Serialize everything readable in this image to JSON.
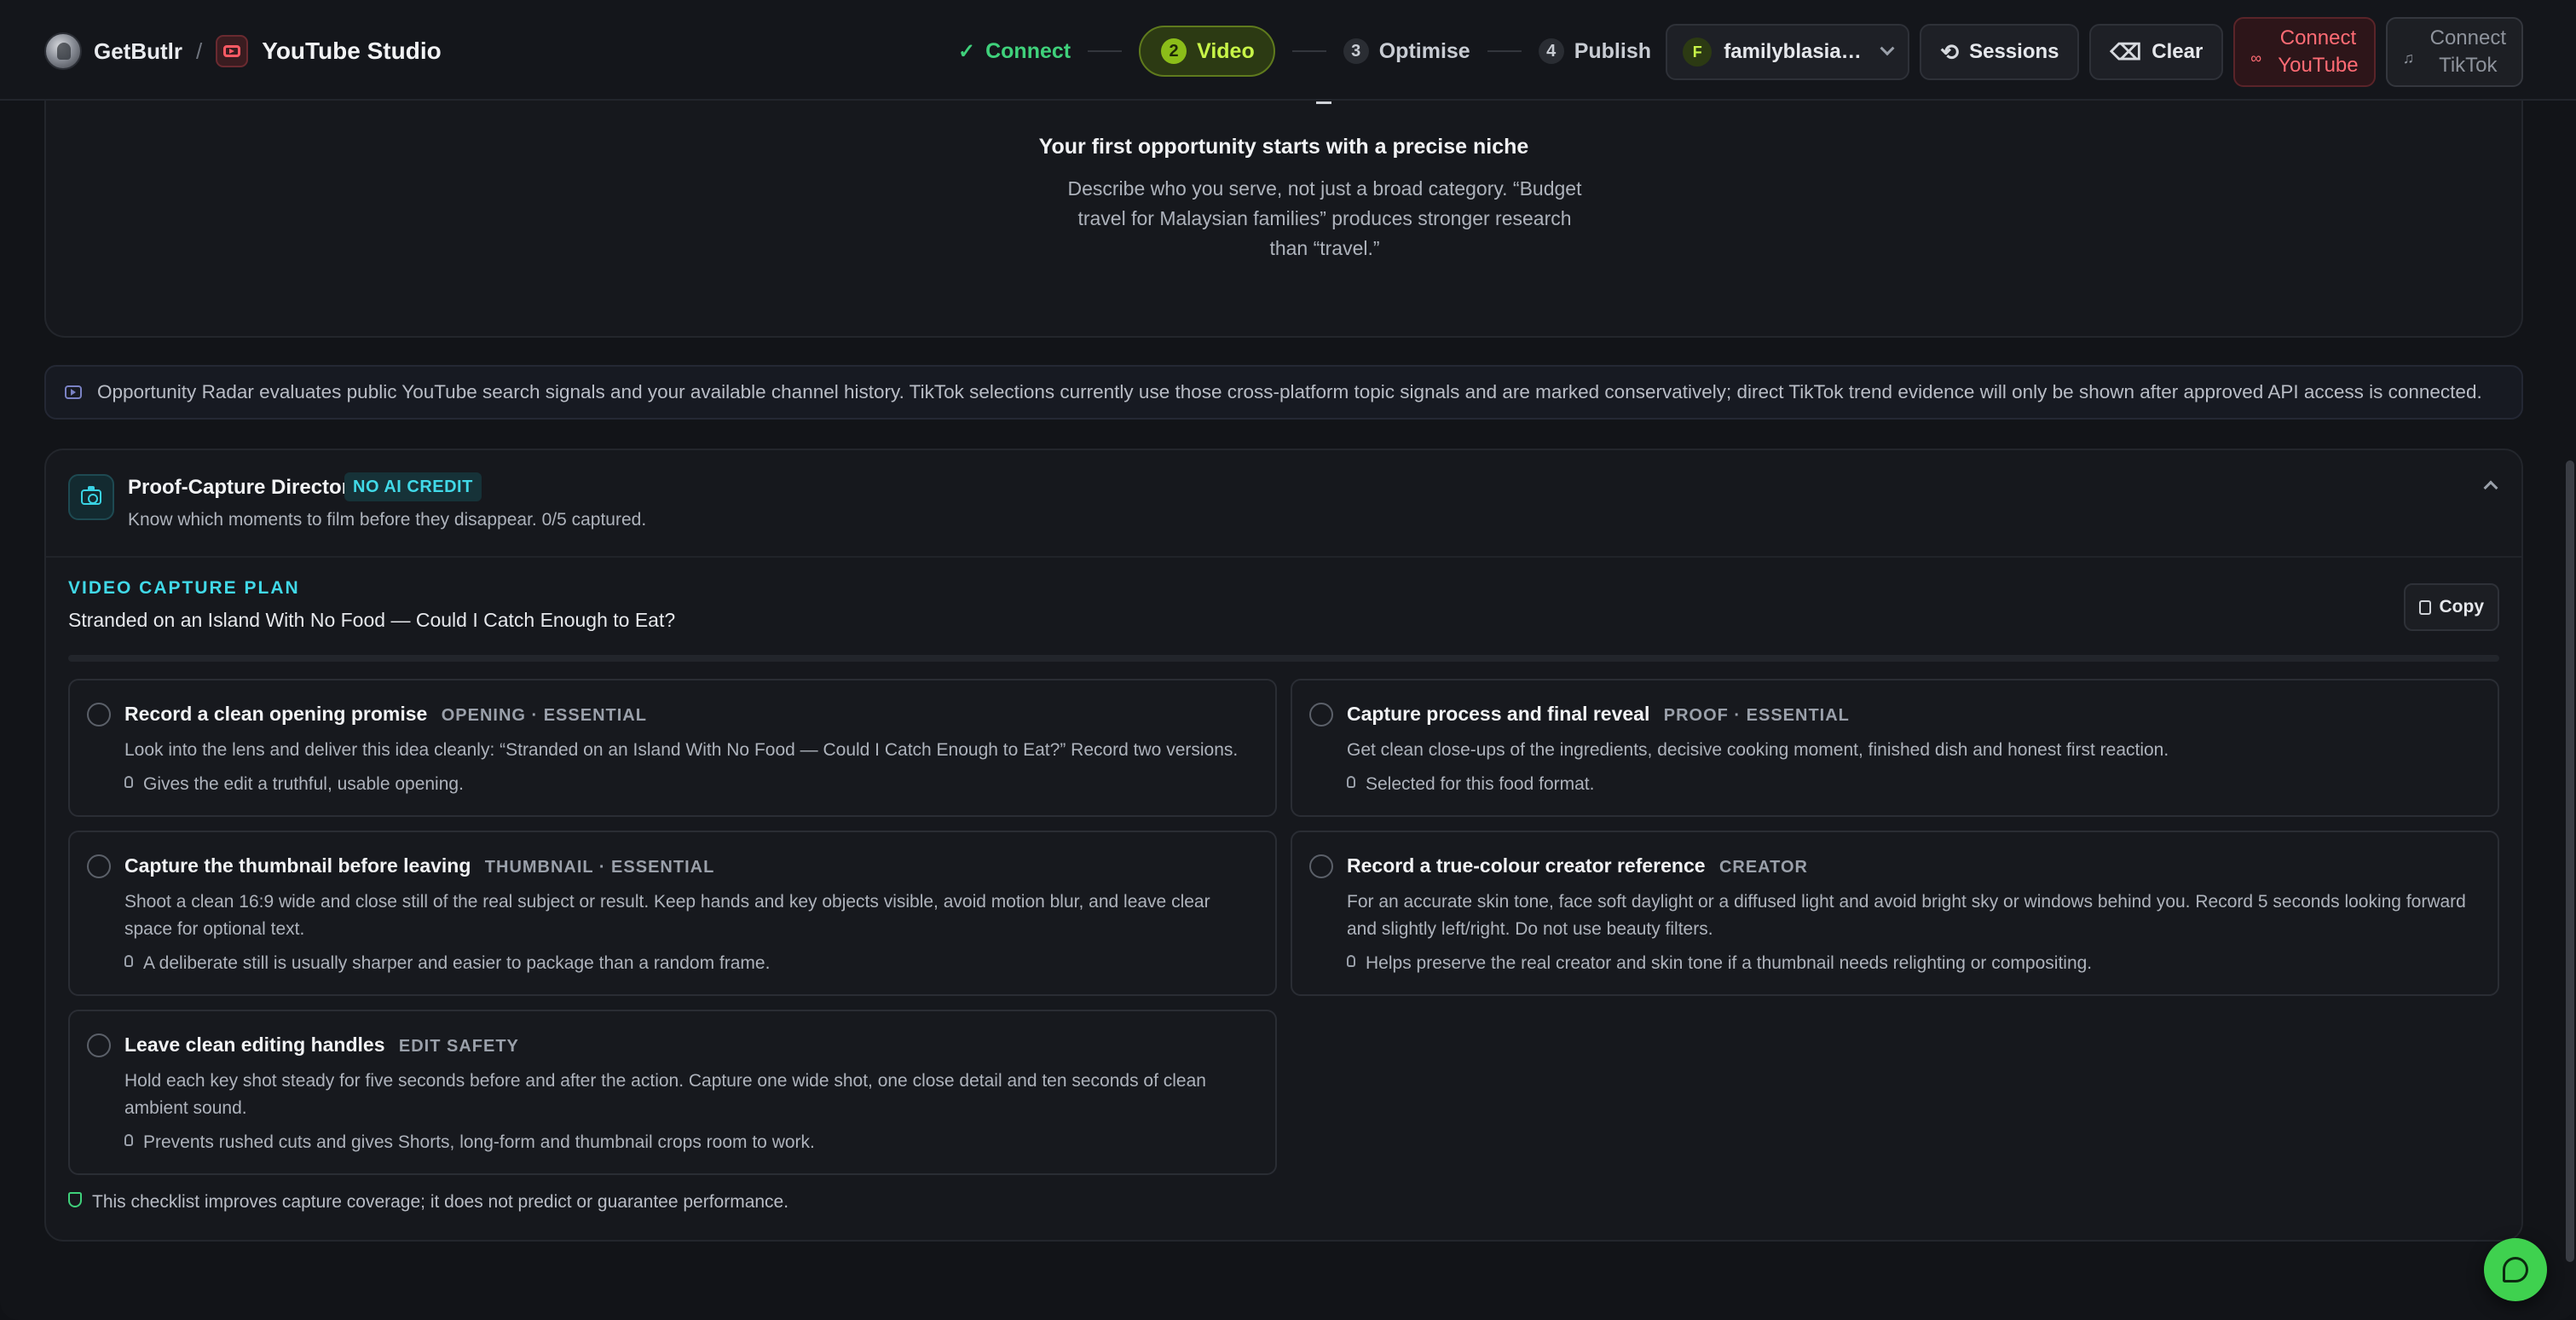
{
  "header": {
    "brand": "GetButlr",
    "separator": "/",
    "studio": "YouTube Studio",
    "steps": [
      {
        "num": "",
        "label": "Connect",
        "state": "done"
      },
      {
        "num": "2",
        "label": "Video",
        "state": "active"
      },
      {
        "num": "3",
        "label": "Optimise",
        "state": "pending"
      },
      {
        "num": "4",
        "label": "Publish",
        "state": "pending"
      }
    ],
    "account_initial": "F",
    "account_name": "familyblasian...",
    "sessions_label": "Sessions",
    "clear_label": "Clear",
    "connect_youtube_label": "Connect YouTube",
    "connect_youtube_line1": "Connect",
    "connect_youtube_line2": "YouTube",
    "connect_tiktok_line1": "Connect",
    "connect_tiktok_line2": "TikTok"
  },
  "niche": {
    "title": "Your first opportunity starts with a precise niche",
    "description": "Describe who you serve, not just a broad category. “Budget travel for Malaysian families” produces stronger research than “travel.”"
  },
  "radar": {
    "text": "Opportunity Radar evaluates public YouTube search signals and your available channel history. TikTok selections currently use those cross-platform topic signals and are marked conservatively; direct TikTok trend evidence will only be shown after approved API access is connected."
  },
  "director": {
    "title": "Proof-Capture Director",
    "badge": "NO AI CREDIT",
    "subtitle": "Know which moments to film before they disappear. 0/5 captured.",
    "captured": 0,
    "total": 5,
    "plan_kicker": "VIDEO CAPTURE PLAN",
    "plan_title": "Stranded on an Island With No Food — Could I Catch Enough to Eat?",
    "copy_label": "Copy",
    "items": [
      {
        "title": "Record a clean opening promise",
        "tag": "OPENING · ESSENTIAL",
        "description": "Look into the lens and deliver this idea cleanly: “Stranded on an Island With No Food — Could I Catch Enough to Eat?” Record two versions.",
        "why": "Gives the edit a truthful, usable opening.",
        "checked": false
      },
      {
        "title": "Capture process and final reveal",
        "tag": "PROOF · ESSENTIAL",
        "description": "Get clean close-ups of the ingredients, decisive cooking moment, finished dish and honest first reaction.",
        "why": "Selected for this food format.",
        "checked": false
      },
      {
        "title": "Capture the thumbnail before leaving",
        "tag": "THUMBNAIL · ESSENTIAL",
        "description": "Shoot a clean 16:9 wide and close still of the real subject or result. Keep hands and key objects visible, avoid motion blur, and leave clear space for optional text.",
        "why": "A deliberate still is usually sharper and easier to package than a random frame.",
        "checked": false
      },
      {
        "title": "Record a true-colour creator reference",
        "tag": "CREATOR",
        "description": "For an accurate skin tone, face soft daylight or a diffused light and avoid bright sky or windows behind you. Record 5 seconds looking forward and slightly left/right. Do not use beauty filters.",
        "why": "Helps preserve the real creator and skin tone if a thumbnail needs relighting or compositing.",
        "checked": false
      },
      {
        "title": "Leave clean editing handles",
        "tag": "EDIT SAFETY",
        "description": "Hold each key shot steady for five seconds before and after the action. Capture one wide shot, one close detail and ten seconds of clean ambient sound.",
        "why": "Prevents rushed cuts and gives Shorts, long-form and thumbnail crops room to work.",
        "checked": false
      }
    ],
    "footnote": "This checklist improves capture coverage; it does not predict or guarantee performance."
  },
  "colors": {
    "accent_cyan": "#41d9e8",
    "accent_lime": "#c8f548",
    "success_green": "#3fd17b",
    "youtube_red": "#ff6b74",
    "chat_green": "#3fd14f"
  }
}
